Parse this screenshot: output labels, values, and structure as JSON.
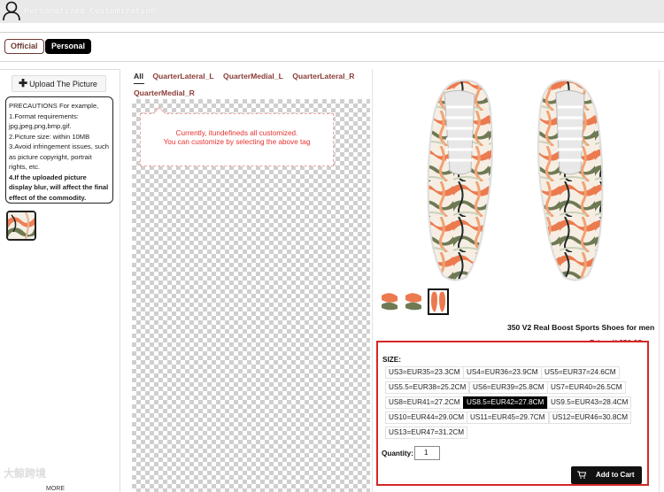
{
  "header": {
    "title": "Personalized Customization",
    "user_icon": "user-icon"
  },
  "tabs": {
    "official": "Official",
    "personal": "Personal"
  },
  "sidebar": {
    "upload_label": "Upload The Picture",
    "precautions_lines": [
      "PRECAUTIONS For example,",
      "1.Format requirements:",
      "jpg,jpeg,png,bmp,gif.",
      "2.Picture size: within 10MB",
      "3.Avoid infringement issues, such",
      "as picture copyright, portrait",
      "rights, etc."
    ],
    "precautions_bold": "4.If the uploaded picture display blur, will affect the final effect of the commodity.",
    "watermark": "大鲸跨境",
    "more": "MORE"
  },
  "editor": {
    "tabs": [
      "All",
      "QuarterLateral_L",
      "QuarterMedial_L",
      "QuarterLateral_R"
    ],
    "tabs_row2": "QuarterMedial_R",
    "tip_line1": "Currently, itundefineds all customized.",
    "tip_line2": "You can customize by selecting the above tag"
  },
  "product": {
    "title": "350 V2 Real Boost Sports Shoes for men",
    "price": "Price: ¥ 250.25",
    "size_label": "SIZE:",
    "sizes": [
      "US3=EUR35=23.3CM",
      "US4=EUR36=23.9CM",
      "US5=EUR37=24.6CM",
      "US5.5=EUR38=25.2CM",
      "US6=EUR39=25.8CM",
      "US7=EUR40=26.5CM",
      "US8=EUR41=27.2CM",
      "US8.5=EUR42=27.8CM",
      "US9.5=EUR43=28.4CM",
      "US10=EUR44=29.0CM",
      "US11=EUR45=29.7CM",
      "US12=EUR46=30.8CM",
      "US13=EUR47=31.2CM"
    ],
    "selected_size": "US8.5=EUR42=27.8CM",
    "quantity_label": "Quantity:",
    "quantity": "1",
    "add_to_cart": "Add to Cart"
  },
  "colors": {
    "accent": "#8a3c36",
    "highlight": "#d62626",
    "tip_text": "#e5322e"
  }
}
